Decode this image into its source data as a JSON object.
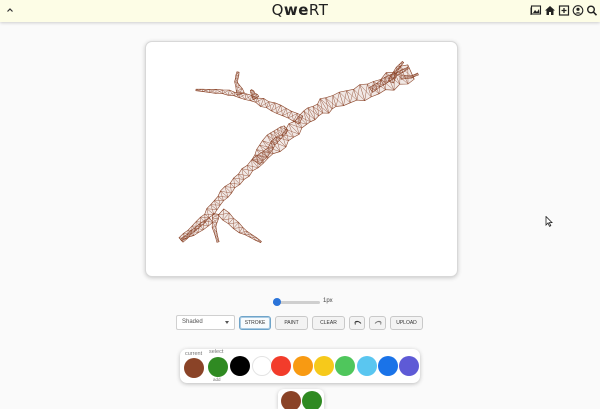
{
  "app": {
    "logo": {
      "q": "Q",
      "we": "we",
      "rt": "RT"
    }
  },
  "icons": {
    "collapse": "chevron-up-icon",
    "gallery": "gallery-icon",
    "home": "home-icon",
    "add": "add-box-icon",
    "account": "account-icon",
    "search": "search-icon",
    "undo": "undo-icon",
    "redo": "redo-icon"
  },
  "stroke_width": {
    "value": 1,
    "min": 1,
    "max": 50,
    "label": "1px"
  },
  "toolbar": {
    "mode": "Shaded",
    "stroke_label": "STROKE",
    "paint_label": "PAINT",
    "clear_label": "CLEAR",
    "upload_label": "UPLOAD",
    "active": "STROKE"
  },
  "palette": {
    "current_label": "current",
    "select_label": "select",
    "add_label": "add",
    "current_color": "#8a4327",
    "select_color": "#2f8a22",
    "colors": [
      "#000000",
      "#ffffff",
      "#f23c2b",
      "#f89a12",
      "#f6c91b",
      "#4fc65c",
      "#5ac6f0",
      "#1a73e8",
      "#5e5ad6"
    ]
  },
  "recent_colors": [
    "#8a4327",
    "#2f8a22"
  ],
  "drawing": {
    "subject": "tree-branch-sketch",
    "stroke_color": "#8a4327"
  }
}
